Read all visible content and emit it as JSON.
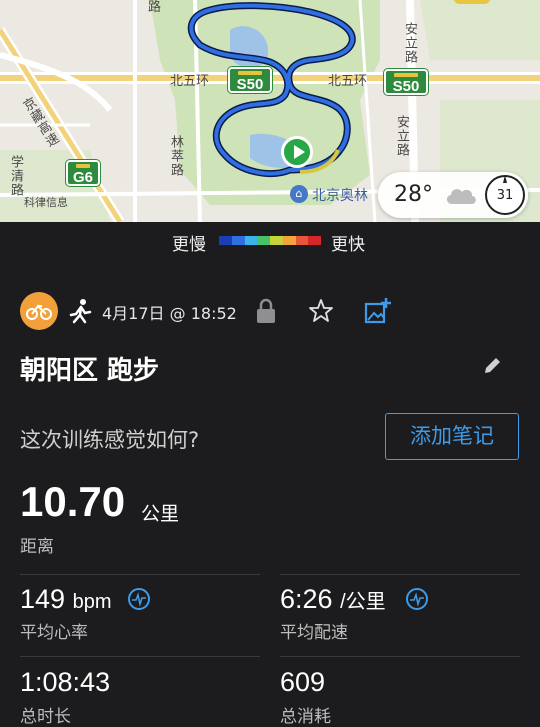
{
  "map": {
    "road_labels": {
      "north_5th_ring_left": "北五环",
      "north_5th_ring_right": "北五环",
      "jingzang": "京藏高速",
      "xueqing": "学清路",
      "linsui": "林萃路",
      "anli": "安立路",
      "anli_upper": "安立路",
      "jianxiang": "科律信息",
      "top_left_road": "路"
    },
    "highway_shields": [
      "S50",
      "S50",
      "G6"
    ],
    "poi_label": "北京奥林",
    "weather": {
      "temperature": "28°",
      "icon": "cloud-icon"
    },
    "compass_value": "31"
  },
  "legend": {
    "slow": "更慢",
    "fast": "更快",
    "colors": [
      "#1a3fb5",
      "#2f6fe0",
      "#3bb5e8",
      "#46c26a",
      "#c8d23a",
      "#f3a43a",
      "#e8563a",
      "#d6262a"
    ]
  },
  "activity": {
    "sport_icon": "bike-icon",
    "type_icon": "running-icon",
    "date": "4月17日 @ 18:52",
    "title": "朝阳区 跑步",
    "feel_question": "这次训练感觉如何?",
    "add_note_label": "添加笔记"
  },
  "stats": {
    "distance": {
      "value": "10.70",
      "unit": "公里",
      "label": "距离"
    },
    "heart_rate": {
      "value": "149",
      "unit": "bpm",
      "label": "平均心率"
    },
    "pace": {
      "value": "6:26",
      "unit": "/公里",
      "label": "平均配速"
    },
    "time": {
      "value": "1:08:43",
      "label": "总时长"
    },
    "calories": {
      "value": "609",
      "label": "总消耗"
    }
  },
  "colors": {
    "accent": "#3d9be9",
    "background": "#1c1c1e",
    "route": "#1f4fd6",
    "start_marker": "#27a746"
  }
}
